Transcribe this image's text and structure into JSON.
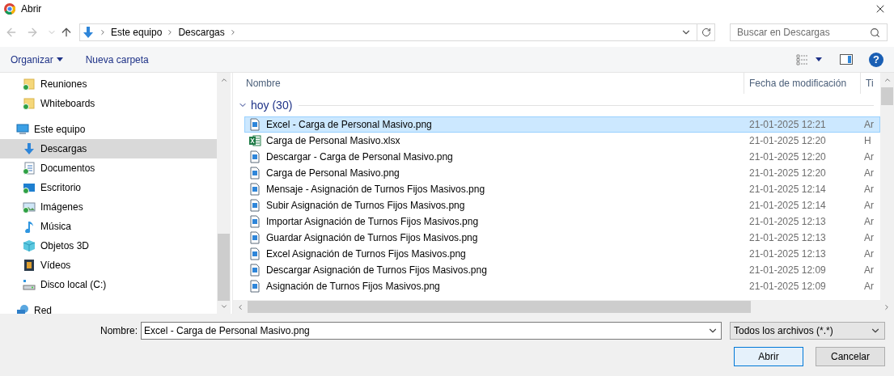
{
  "window": {
    "title": "Abrir"
  },
  "address": {
    "crumbs": [
      "Este equipo",
      "Descargas"
    ]
  },
  "search": {
    "placeholder": "Buscar en Descargas"
  },
  "toolbar": {
    "buttons": [
      "Organizar",
      "Nueva carpeta"
    ],
    "help": "?"
  },
  "sidebar": {
    "items": [
      {
        "label": "Reuniones",
        "kind": "synced-folder",
        "selected": false
      },
      {
        "label": "Whiteboards",
        "kind": "synced-folder",
        "selected": false
      },
      {
        "label": "Este equipo",
        "kind": "pc",
        "selected": false,
        "children": [
          {
            "label": "Descargas",
            "kind": "download",
            "selected": true
          },
          {
            "label": "Documentos",
            "kind": "documents",
            "selected": false
          },
          {
            "label": "Escritorio",
            "kind": "desktop",
            "selected": false
          },
          {
            "label": "Imágenes",
            "kind": "images",
            "selected": false
          },
          {
            "label": "Música",
            "kind": "music",
            "selected": false
          },
          {
            "label": "Objetos 3D",
            "kind": "objects3d",
            "selected": false
          },
          {
            "label": "Vídeos",
            "kind": "videos",
            "selected": false
          },
          {
            "label": "Disco local (C:)",
            "kind": "disk",
            "selected": false
          }
        ]
      },
      {
        "label": "Red",
        "kind": "network",
        "selected": false
      }
    ]
  },
  "table": {
    "columns": [
      "Nombre",
      "Fecha de modificación",
      "Ti"
    ],
    "group": {
      "label": "hoy (30)",
      "expanded": true
    },
    "rows": [
      {
        "name": "Excel - Carga de Personal Masivo.png",
        "date": "21-01-2025 12:21",
        "column_3": "Ar",
        "kind": "image",
        "selected": true
      },
      {
        "name": "Carga de Personal Masivo.xlsx",
        "date": "21-01-2025 12:20",
        "column_3": "H",
        "kind": "excel",
        "selected": false
      },
      {
        "name": "Descargar - Carga de Personal Masivo.png",
        "date": "21-01-2025 12:20",
        "column_3": "Ar",
        "kind": "image",
        "selected": false
      },
      {
        "name": "Carga de Personal Masivo.png",
        "date": "21-01-2025 12:20",
        "column_3": "Ar",
        "kind": "image",
        "selected": false
      },
      {
        "name": "Mensaje - Asignación de Turnos Fijos Masivos.png",
        "date": "21-01-2025 12:14",
        "column_3": "Ar",
        "kind": "image",
        "selected": false
      },
      {
        "name": "Subir Asignación de Turnos Fijos Masivos.png",
        "date": "21-01-2025 12:14",
        "column_3": "Ar",
        "kind": "image",
        "selected": false
      },
      {
        "name": "Importar Asignación de Turnos Fijos Masivos.png",
        "date": "21-01-2025 12:13",
        "column_3": "Ar",
        "kind": "image",
        "selected": false
      },
      {
        "name": "Guardar Asignación de Turnos Fijos Masivos.png",
        "date": "21-01-2025 12:13",
        "column_3": "Ar",
        "kind": "image",
        "selected": false
      },
      {
        "name": "Excel Asignación de Turnos Fijos Masivos.png",
        "date": "21-01-2025 12:13",
        "column_3": "Ar",
        "kind": "image",
        "selected": false
      },
      {
        "name": "Descargar Asignación de Turnos Fijos Masivos.png",
        "date": "21-01-2025 12:09",
        "column_3": "Ar",
        "kind": "image",
        "selected": false
      },
      {
        "name": "Asignación de Turnos Fijos Masivos.png",
        "date": "21-01-2025 12:09",
        "column_3": "Ar",
        "kind": "image",
        "selected": false
      }
    ]
  },
  "footer": {
    "name_label": "Nombre:",
    "name_value": "Excel - Carga de Personal Masivo.png",
    "filter": "Todos los archivos (*.*)",
    "buttons": [
      {
        "label": "Abrir",
        "kind": "primary"
      },
      {
        "label": "Cancelar",
        "kind": "secondary"
      }
    ]
  }
}
